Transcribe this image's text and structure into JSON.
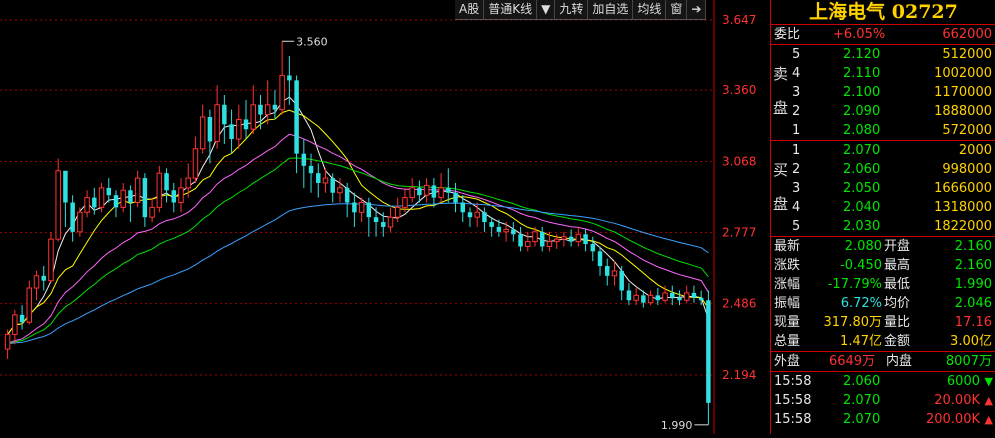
{
  "toolbar": {
    "items": [
      "A股",
      "普通K线",
      "▼",
      "九转",
      "加自选",
      "均线",
      "窗",
      "➔"
    ]
  },
  "chart_data": {
    "type": "candlestick",
    "price_axis_ticks": [
      "3.647",
      "3.360",
      "3.068",
      "2.777",
      "2.486",
      "2.194"
    ],
    "ylim": [
      1.9,
      3.65
    ],
    "high_marker": "3.560",
    "low_marker": "1.990",
    "candles": [
      [
        2.3,
        2.36,
        2.26,
        2.38
      ],
      [
        2.36,
        2.44,
        2.32,
        2.46
      ],
      [
        2.44,
        2.41,
        2.38,
        2.48
      ],
      [
        2.41,
        2.55,
        2.4,
        2.58
      ],
      [
        2.55,
        2.6,
        2.5,
        2.62
      ],
      [
        2.6,
        2.58,
        2.54,
        2.64
      ],
      [
        2.58,
        2.75,
        2.57,
        2.78
      ],
      [
        2.75,
        3.03,
        2.74,
        3.08
      ],
      [
        3.03,
        2.9,
        2.8,
        3.0
      ],
      [
        2.9,
        2.78,
        2.74,
        2.93
      ],
      [
        2.78,
        2.86,
        2.76,
        2.88
      ],
      [
        2.86,
        2.92,
        2.84,
        2.95
      ],
      [
        2.92,
        2.88,
        2.85,
        2.96
      ],
      [
        2.88,
        2.96,
        2.86,
        2.98
      ],
      [
        2.96,
        2.93,
        2.9,
        3.0
      ],
      [
        2.93,
        2.88,
        2.84,
        2.95
      ],
      [
        2.88,
        2.95,
        2.86,
        2.98
      ],
      [
        2.95,
        2.9,
        2.82,
        2.97
      ],
      [
        2.9,
        3.0,
        2.88,
        3.03
      ],
      [
        3.0,
        2.84,
        2.8,
        3.02
      ],
      [
        2.84,
        2.88,
        2.82,
        2.92
      ],
      [
        2.88,
        3.02,
        2.86,
        3.05
      ],
      [
        3.02,
        2.95,
        2.9,
        3.04
      ],
      [
        2.95,
        2.9,
        2.86,
        2.98
      ],
      [
        2.9,
        2.96,
        2.86,
        3.0
      ],
      [
        2.96,
        3.0,
        2.92,
        3.06
      ],
      [
        3.0,
        3.12,
        2.98,
        3.17
      ],
      [
        3.12,
        3.25,
        3.1,
        3.3
      ],
      [
        3.25,
        3.15,
        3.06,
        3.28
      ],
      [
        3.15,
        3.3,
        3.12,
        3.38
      ],
      [
        3.3,
        3.22,
        3.14,
        3.34
      ],
      [
        3.22,
        3.16,
        3.1,
        3.28
      ],
      [
        3.16,
        3.24,
        3.12,
        3.3
      ],
      [
        3.24,
        3.2,
        3.16,
        3.32
      ],
      [
        3.2,
        3.3,
        3.18,
        3.38
      ],
      [
        3.3,
        3.26,
        3.2,
        3.34
      ],
      [
        3.26,
        3.3,
        3.22,
        3.4
      ],
      [
        3.3,
        3.28,
        3.24,
        3.36
      ],
      [
        3.28,
        3.42,
        3.26,
        3.56
      ],
      [
        3.42,
        3.4,
        3.3,
        3.5
      ],
      [
        3.4,
        3.1,
        3.02,
        3.42
      ],
      [
        3.1,
        3.05,
        2.96,
        3.16
      ],
      [
        3.05,
        3.02,
        2.94,
        3.1
      ],
      [
        3.02,
        2.98,
        2.92,
        3.06
      ],
      [
        2.98,
        3.0,
        2.94,
        3.04
      ],
      [
        3.0,
        2.94,
        2.9,
        3.02
      ],
      [
        2.94,
        2.96,
        2.9,
        3.0
      ],
      [
        2.96,
        2.9,
        2.84,
        2.98
      ],
      [
        2.9,
        2.86,
        2.8,
        2.94
      ],
      [
        2.86,
        2.9,
        2.82,
        2.92
      ],
      [
        2.9,
        2.84,
        2.76,
        2.92
      ],
      [
        2.84,
        2.82,
        2.76,
        2.88
      ],
      [
        2.82,
        2.8,
        2.76,
        2.86
      ],
      [
        2.8,
        2.84,
        2.78,
        2.88
      ],
      [
        2.84,
        2.88,
        2.82,
        2.92
      ],
      [
        2.88,
        2.92,
        2.86,
        2.96
      ],
      [
        2.92,
        2.96,
        2.9,
        3.0
      ],
      [
        2.96,
        2.93,
        2.9,
        2.99
      ],
      [
        2.93,
        2.97,
        2.9,
        3.0
      ],
      [
        2.97,
        2.92,
        2.88,
        3.0
      ],
      [
        2.92,
        2.96,
        2.9,
        3.02
      ],
      [
        2.96,
        2.94,
        2.9,
        3.04
      ],
      [
        2.94,
        2.9,
        2.86,
        2.98
      ],
      [
        2.9,
        2.86,
        2.82,
        2.93
      ],
      [
        2.86,
        2.84,
        2.8,
        2.88
      ],
      [
        2.84,
        2.86,
        2.8,
        2.9
      ],
      [
        2.86,
        2.82,
        2.78,
        2.88
      ],
      [
        2.82,
        2.8,
        2.76,
        2.84
      ],
      [
        2.8,
        2.78,
        2.76,
        2.83
      ],
      [
        2.78,
        2.79,
        2.74,
        2.82
      ],
      [
        2.79,
        2.77,
        2.74,
        2.82
      ],
      [
        2.77,
        2.72,
        2.7,
        2.8
      ],
      [
        2.72,
        2.74,
        2.7,
        2.78
      ],
      [
        2.74,
        2.78,
        2.72,
        2.8
      ],
      [
        2.78,
        2.72,
        2.7,
        2.8
      ],
      [
        2.72,
        2.74,
        2.7,
        2.78
      ],
      [
        2.74,
        2.75,
        2.71,
        2.77
      ],
      [
        2.75,
        2.76,
        2.72,
        2.78
      ],
      [
        2.76,
        2.74,
        2.72,
        2.79
      ],
      [
        2.74,
        2.77,
        2.72,
        2.8
      ],
      [
        2.77,
        2.73,
        2.7,
        2.79
      ],
      [
        2.73,
        2.7,
        2.66,
        2.76
      ],
      [
        2.7,
        2.64,
        2.6,
        2.72
      ],
      [
        2.64,
        2.6,
        2.56,
        2.67
      ],
      [
        2.6,
        2.62,
        2.56,
        2.66
      ],
      [
        2.62,
        2.54,
        2.5,
        2.64
      ],
      [
        2.54,
        2.5,
        2.48,
        2.57
      ],
      [
        2.5,
        2.52,
        2.48,
        2.55
      ],
      [
        2.52,
        2.49,
        2.47,
        2.54
      ],
      [
        2.49,
        2.52,
        2.48,
        2.54
      ],
      [
        2.52,
        2.5,
        2.48,
        2.55
      ],
      [
        2.5,
        2.53,
        2.49,
        2.56
      ],
      [
        2.53,
        2.51,
        2.48,
        2.56
      ],
      [
        2.51,
        2.5,
        2.48,
        2.54
      ],
      [
        2.5,
        2.53,
        2.49,
        2.56
      ],
      [
        2.53,
        2.51,
        2.49,
        2.56
      ],
      [
        2.51,
        2.5,
        2.48,
        2.54
      ],
      [
        2.5,
        2.08,
        1.99,
        2.54
      ]
    ]
  },
  "panel": {
    "title": "上海电气 02727",
    "weibi": {
      "label": "委比",
      "pct": "+6.05%",
      "diff": "662000"
    },
    "sell_label": [
      "卖",
      "盘"
    ],
    "buy_label": [
      "买",
      "盘"
    ],
    "sell": [
      {
        "n": "5",
        "price": "2.120",
        "vol": "512000"
      },
      {
        "n": "4",
        "price": "2.110",
        "vol": "1002000"
      },
      {
        "n": "3",
        "price": "2.100",
        "vol": "1170000"
      },
      {
        "n": "2",
        "price": "2.090",
        "vol": "1888000"
      },
      {
        "n": "1",
        "price": "2.080",
        "vol": "572000"
      }
    ],
    "buy": [
      {
        "n": "1",
        "price": "2.070",
        "vol": "2000"
      },
      {
        "n": "2",
        "price": "2.060",
        "vol": "998000"
      },
      {
        "n": "3",
        "price": "2.050",
        "vol": "1666000"
      },
      {
        "n": "4",
        "price": "2.040",
        "vol": "1318000"
      },
      {
        "n": "5",
        "price": "2.030",
        "vol": "1822000"
      }
    ],
    "stats": [
      {
        "l1": "最新",
        "v1": "2.080",
        "c1": "green",
        "l2": "开盘",
        "v2": "2.160",
        "c2": "green"
      },
      {
        "l1": "涨跌",
        "v1": "-0.450",
        "c1": "green",
        "l2": "最高",
        "v2": "2.160",
        "c2": "green"
      },
      {
        "l1": "涨幅",
        "v1": "-17.79%",
        "c1": "green",
        "l2": "最低",
        "v2": "1.990",
        "c2": "green"
      },
      {
        "l1": "振幅",
        "v1": "6.72%",
        "c1": "cyan",
        "l2": "均价",
        "v2": "2.046",
        "c2": "green"
      },
      {
        "l1": "现量",
        "v1": "317.80万",
        "c1": "yellow",
        "l2": "量比",
        "v2": "17.16",
        "c2": "red"
      },
      {
        "l1": "总量",
        "v1": "1.47亿",
        "c1": "yellow",
        "l2": "金额",
        "v2": "3.00亿",
        "c2": "yellow"
      }
    ],
    "outer": {
      "l1": "外盘",
      "v1": "6649万",
      "l2": "内盘",
      "v2": "8007万"
    },
    "ticks": [
      {
        "time": "15:58",
        "price": "2.060",
        "vol": "6000",
        "dir": "down"
      },
      {
        "time": "15:58",
        "price": "2.070",
        "vol": "20.00K",
        "dir": "up"
      },
      {
        "time": "15:58",
        "price": "2.070",
        "vol": "200.00K",
        "dir": "up"
      }
    ]
  },
  "colors": {
    "up": "#ff3232",
    "down": "#2fe0e0",
    "bg": "#000000",
    "grid": "#a00000",
    "ma5": "#f0f0f0",
    "ma10": "#ffff00",
    "ma20": "#ff66ff",
    "ma30": "#00e000",
    "ma60": "#3aa0ff"
  }
}
